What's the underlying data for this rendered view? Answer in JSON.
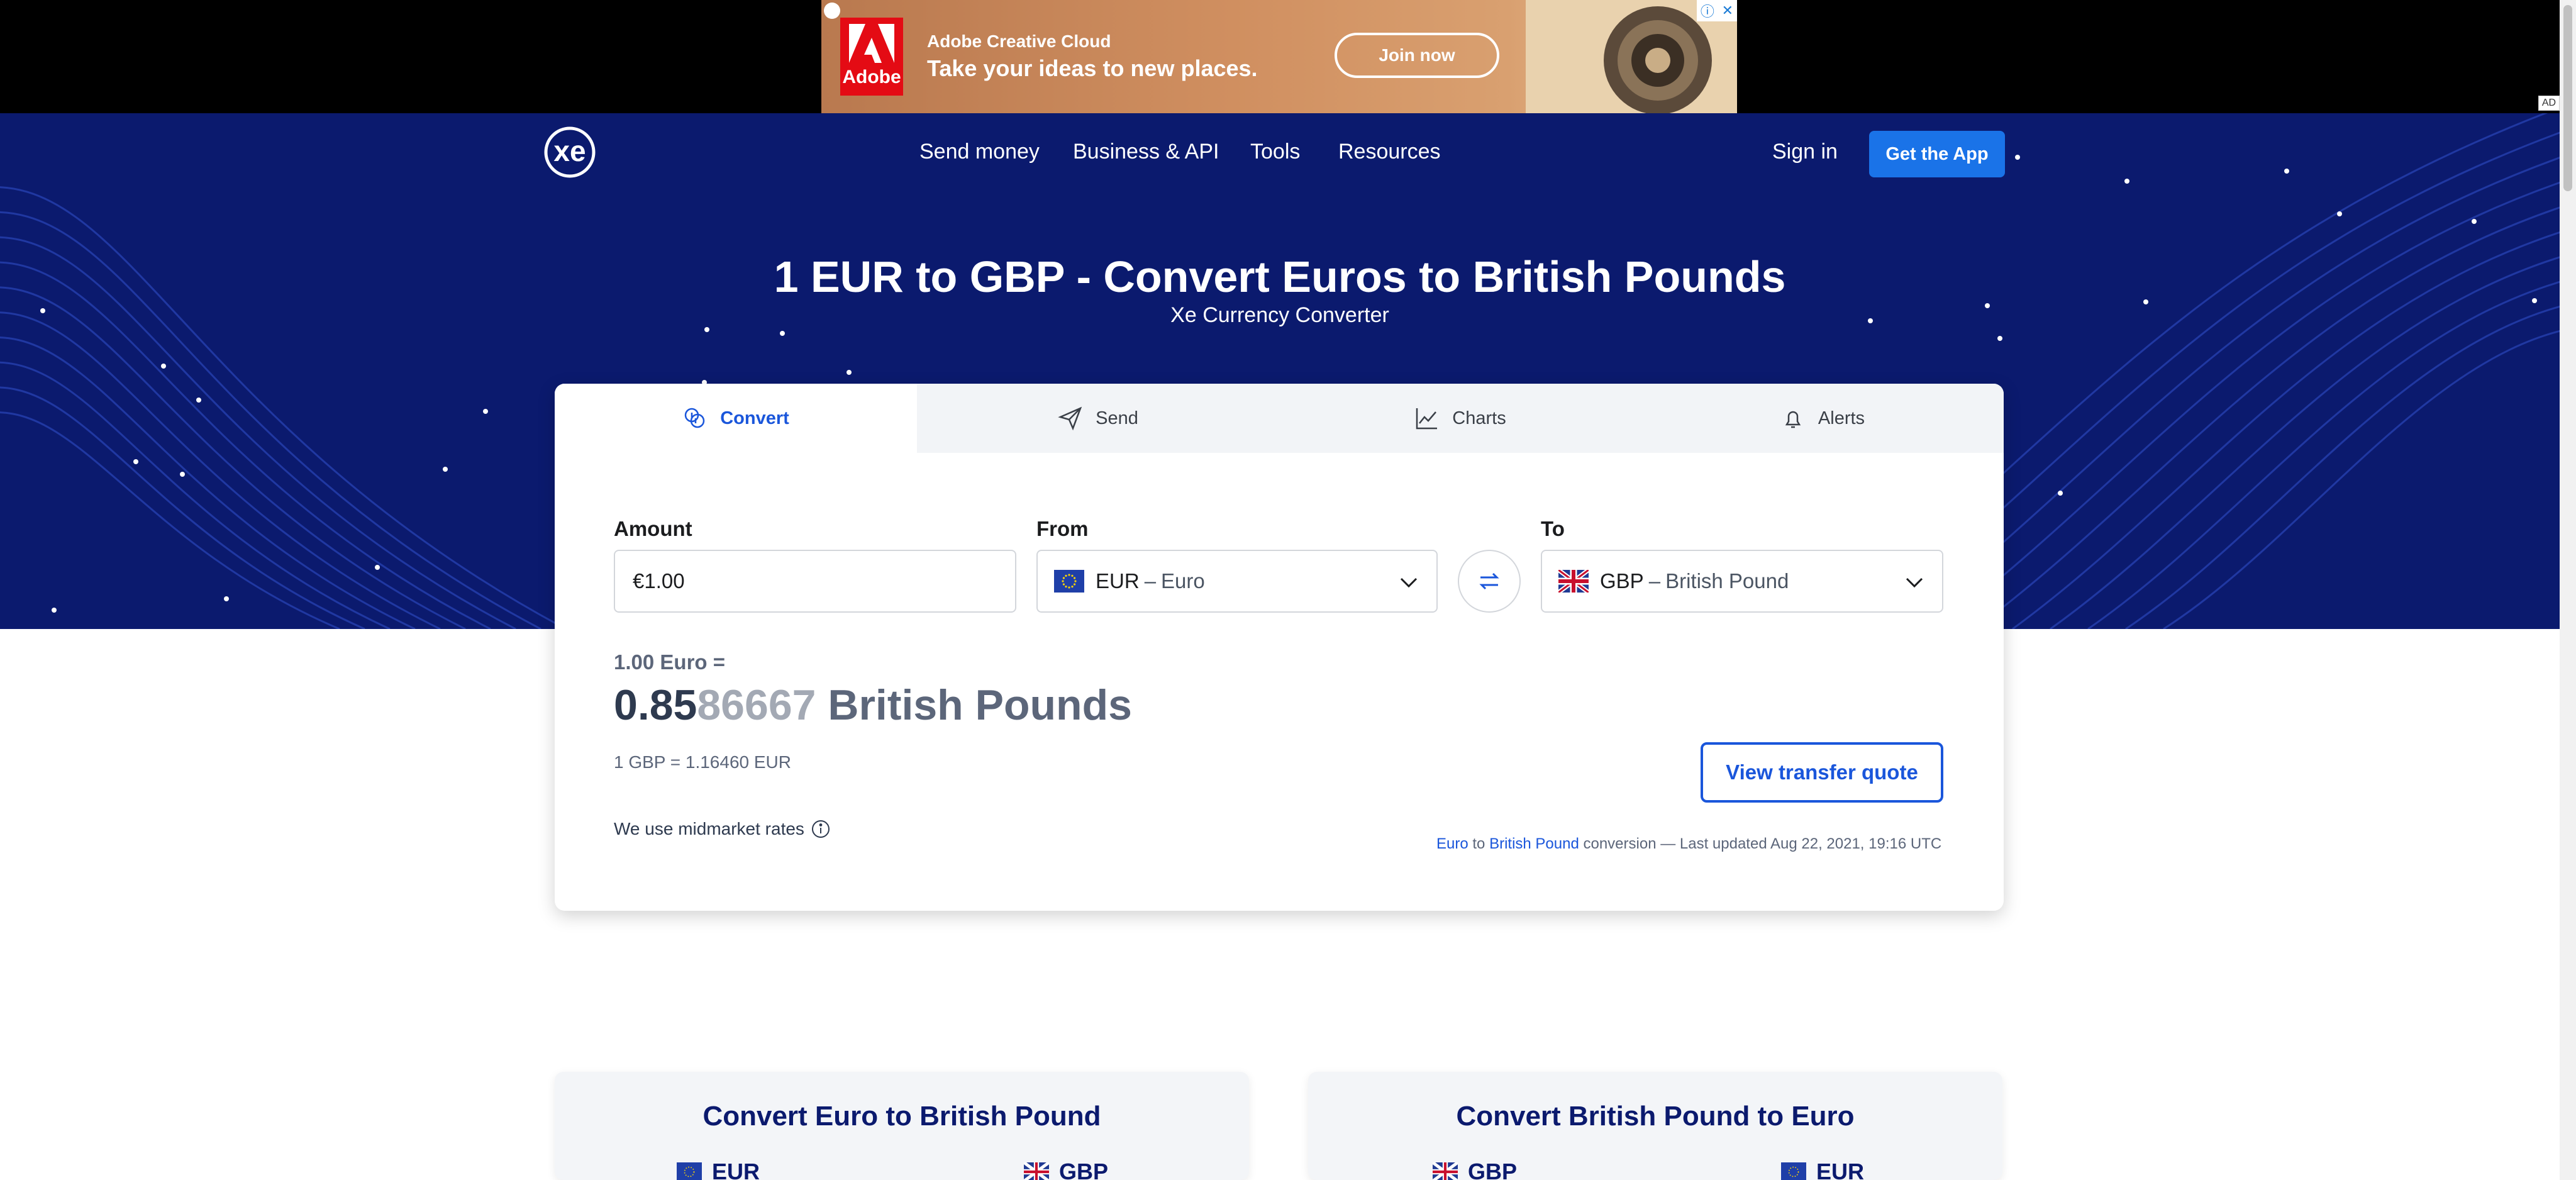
{
  "ad": {
    "brand": "Adobe",
    "line1": "Adobe Creative Cloud",
    "line2": "Take your ideas to new places.",
    "cta": "Join now",
    "tag": "AD"
  },
  "nav": {
    "items": [
      "Send money",
      "Business & API",
      "Tools",
      "Resources"
    ],
    "sign_in": "Sign in",
    "get_app": "Get the App"
  },
  "hero": {
    "title": "1 EUR to GBP - Convert Euros to British Pounds",
    "subtitle": "Xe Currency Converter"
  },
  "tabs": [
    {
      "label": "Convert",
      "icon": "coins-icon",
      "active": true
    },
    {
      "label": "Send",
      "icon": "paper-plane-icon",
      "active": false
    },
    {
      "label": "Charts",
      "icon": "line-chart-icon",
      "active": false
    },
    {
      "label": "Alerts",
      "icon": "bell-icon",
      "active": false
    }
  ],
  "converter": {
    "amount_label": "Amount",
    "amount_value": "€1.00",
    "from_label": "From",
    "from_code": "EUR",
    "from_name": "Euro",
    "to_label": "To",
    "to_code": "GBP",
    "to_name": "British Pound",
    "separator": "–"
  },
  "result": {
    "small": "1.00 Euro =",
    "big_main": "0.85",
    "big_rest": "86667",
    "big_unit": "British Pounds",
    "inverse": "1 GBP = 1.16460 EUR",
    "quote_button": "View transfer quote",
    "midmarket": "We use midmarket rates",
    "updated_from": "Euro",
    "updated_to_word": "to",
    "updated_to": "British Pound",
    "updated_rest": "conversion — Last updated Aug 22, 2021, 19:16 UTC"
  },
  "bottom": [
    {
      "title": "Convert Euro to British Pound",
      "left": "EUR",
      "right": "GBP"
    },
    {
      "title": "Convert British Pound to Euro",
      "left": "GBP",
      "right": "EUR"
    }
  ],
  "colors": {
    "hero_bg": "#0b1a6e",
    "accent": "#1a56db",
    "button": "#1a73e8"
  }
}
